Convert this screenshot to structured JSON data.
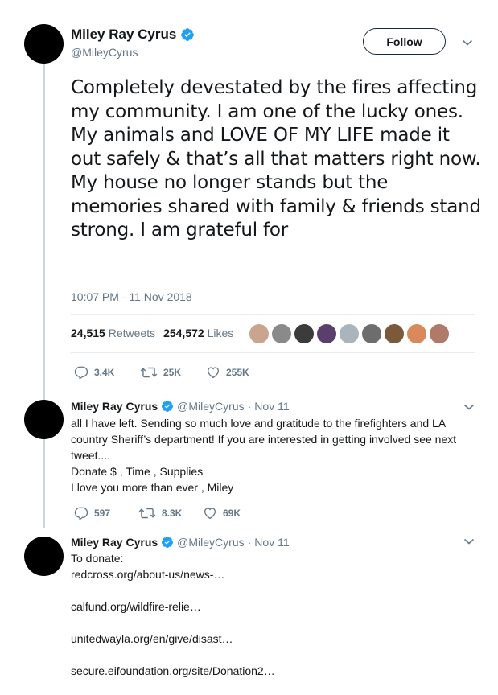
{
  "main_tweet": {
    "name": "Miley Ray Cyrus",
    "handle": "@MileyCyrus",
    "follow_label": "Follow",
    "text": "Completely devestated by the fires affecting my community. I am one of the lucky ones. My animals and LOVE OF MY LIFE made it out safely & that’s all that matters right now. My house no longer stands but the memories shared with family & friends stand strong. I am grateful for",
    "timestamp": "10:07 PM - 11 Nov 2018",
    "retweets_count": "24,515",
    "retweets_label": "Retweets",
    "likes_count": "254,572",
    "likes_label": "Likes",
    "reply_count": "3.4K",
    "retweet_count_short": "25K",
    "like_count_short": "255K"
  },
  "liker_colors": [
    "#c9a58f",
    "#8a8a8a",
    "#3b3b3b",
    "#5a3e6b",
    "#aab4bd",
    "#6d6d6d",
    "#7a5a3a",
    "#d98a5a",
    "#b07a6a"
  ],
  "replies": [
    {
      "name": "Miley Ray Cyrus",
      "handle": "@MileyCyrus",
      "sep": "·",
      "date": "Nov 11",
      "text": "all I have left. Sending so much love and gratitude to the firefighters and LA country Sheriff’s department!  If you are interested in getting involved see next tweet....",
      "line2": "Donate $ , Time , Supplies",
      "line3": "I love you more than ever , Miley",
      "reply_count": "597",
      "retweet_count": "8.3K",
      "like_count": "69K"
    },
    {
      "name": "Miley Ray Cyrus",
      "handle": "@MileyCyrus",
      "sep": "·",
      "date": "Nov 11",
      "intro": "To donate:",
      "links": [
        "redcross.org/about-us/news-…",
        "calfund.org/wildfire-relie…",
        "unitedwayla.org/en/give/disast…",
        "secure.eifoundation.org/site/Donation2…"
      ]
    }
  ],
  "colors": {
    "text": "#14171a",
    "secondary": "#657786",
    "verified": "#1da1f2",
    "divider": "#e6ecf0"
  }
}
